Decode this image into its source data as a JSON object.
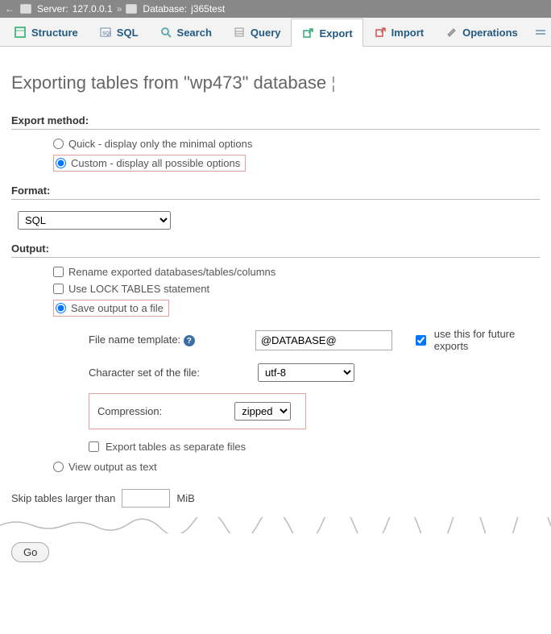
{
  "breadcrumb": {
    "server_label": "Server:",
    "server_value": "127.0.0.1",
    "db_label": "Database:",
    "db_value": "j365test"
  },
  "tabs": {
    "structure": "Structure",
    "sql": "SQL",
    "search": "Search",
    "query": "Query",
    "export": "Export",
    "import": "Import",
    "operations": "Operations"
  },
  "title": "Exporting tables from \"wp473\" database",
  "sections": {
    "export_method": "Export method:",
    "format": "Format:",
    "output": "Output:"
  },
  "export_method": {
    "quick": "Quick - display only the minimal options",
    "custom": "Custom - display all possible options"
  },
  "format_value": "SQL",
  "output": {
    "rename": "Rename exported databases/tables/columns",
    "lock_pre": "Use ",
    "lock_caps": "LOCK TABLES",
    "lock_post": " statement",
    "save_to_file": "Save output to a file",
    "file_template_label": "File name template:",
    "file_template_value": "@DATABASE@",
    "use_future": "use this for future exports",
    "charset_label": "Character set of the file:",
    "charset_value": "utf-8",
    "compression_label": "Compression:",
    "compression_value": "zipped",
    "separate_files": "Export tables as separate files",
    "view_as_text": "View output as text",
    "skip_label": "Skip tables larger than",
    "skip_unit": "MiB"
  },
  "go": "Go"
}
